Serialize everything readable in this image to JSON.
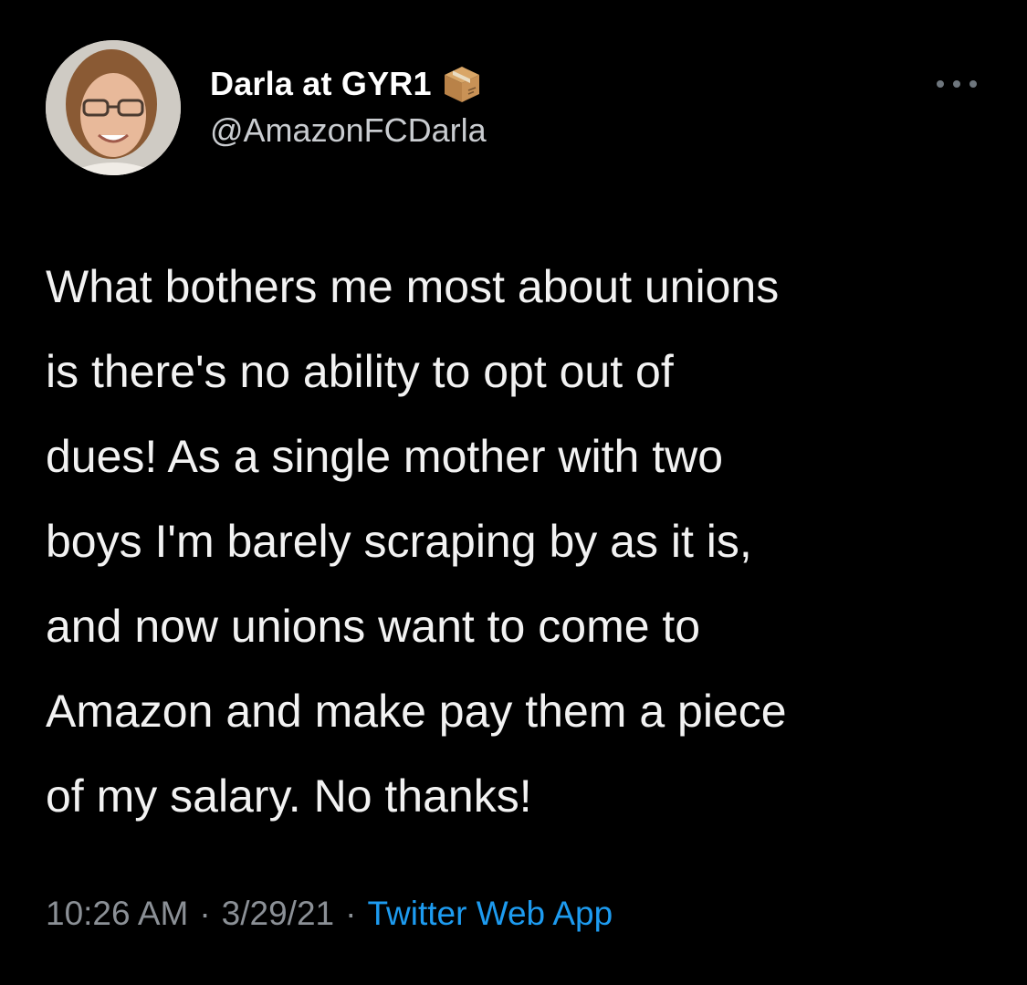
{
  "author": {
    "display_name": "Darla at GYR1",
    "handle": "@AmazonFCDarla",
    "name_emoji_icon": "package-box-icon",
    "avatar_icon": "profile-photo"
  },
  "menu": {
    "more_icon": "more-horizontal-icon"
  },
  "tweet": {
    "text": "What bothers me most about unions\nis there's no ability to opt out of\ndues! As a single mother with two\nboys I'm barely scraping by as it is,\nand now unions want to come to\nAmazon and make pay them a piece\nof my salary. No thanks!"
  },
  "meta": {
    "time": "10:26 AM",
    "separator": "·",
    "date": "3/29/21",
    "source": "Twitter Web App"
  },
  "colors": {
    "background": "#000000",
    "text": "#f2f2f2",
    "secondary_text": "#8b9096",
    "link": "#1d9bf0"
  }
}
